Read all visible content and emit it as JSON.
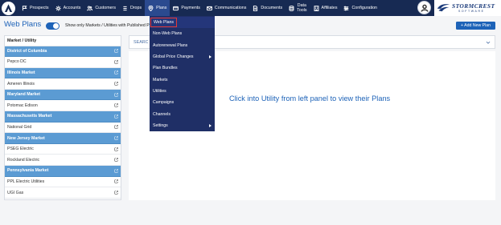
{
  "nav": {
    "items": [
      {
        "label": "Prospects",
        "icon": "flag-icon"
      },
      {
        "label": "Accounts",
        "icon": "gear-icon"
      },
      {
        "label": "Customers",
        "icon": "users-icon"
      },
      {
        "label": "Drops",
        "icon": "drop-icon"
      },
      {
        "label": "Plans",
        "icon": "pin-icon"
      },
      {
        "label": "Payments",
        "icon": "card-icon"
      },
      {
        "label": "Communications",
        "icon": "mail-icon"
      },
      {
        "label": "Documents",
        "icon": "document-icon"
      },
      {
        "label_line1": "Data",
        "label_line2": "Tools",
        "icon": "database-icon"
      },
      {
        "label": "Affiliates",
        "icon": "building-icon"
      },
      {
        "label": "Configuration",
        "icon": "sliders-icon"
      }
    ],
    "active": "Plans"
  },
  "brand": {
    "name": "STORMCREST",
    "sub": "SOFTWARE"
  },
  "page": {
    "title": "Web Plans",
    "toggle_label": "Show only Markets / Utilities with Published P",
    "toggle_on": true,
    "add_button": "+ Add New Plan"
  },
  "left_panel": {
    "header": "Market / Utility",
    "rows": [
      {
        "type": "market",
        "label": "District of Columbia"
      },
      {
        "type": "utility",
        "label": "Pepco DC"
      },
      {
        "type": "market",
        "label": "Illinois Market"
      },
      {
        "type": "utility",
        "label": "Ameren Illinois"
      },
      {
        "type": "market",
        "label": "Maryland Market"
      },
      {
        "type": "utility",
        "label": "Potomac Edison"
      },
      {
        "type": "market",
        "label": "Massachusetts Market"
      },
      {
        "type": "utility",
        "label": "National Grid"
      },
      {
        "type": "market",
        "label": "New Jersey Market"
      },
      {
        "type": "utility",
        "label": "PSEG Electric"
      },
      {
        "type": "utility",
        "label": "Rockland Electric"
      },
      {
        "type": "market",
        "label": "Pennsylvania Market"
      },
      {
        "type": "utility",
        "label": "PPL Electric Utilities"
      },
      {
        "type": "utility",
        "label": "UGI Gas"
      }
    ]
  },
  "search": {
    "label": "SEARC"
  },
  "main": {
    "empty_message": "Click into Utility from left panel to view their Plans"
  },
  "plans_menu": {
    "items": [
      {
        "label": "Web Plans",
        "highlighted": true,
        "submenu": false
      },
      {
        "label": "Non-Web Plans",
        "submenu": false
      },
      {
        "label": "Autorenewal Plans",
        "submenu": false
      },
      {
        "label": "Global Price Changes",
        "submenu": true
      },
      {
        "label": "Plan Bundles",
        "submenu": false
      },
      {
        "label": "Markets",
        "submenu": false
      },
      {
        "label": "Utilities",
        "submenu": false
      },
      {
        "label": "Campaigns",
        "submenu": false
      },
      {
        "label": "Channels",
        "submenu": false
      },
      {
        "label": "Settings",
        "submenu": true
      }
    ]
  },
  "colors": {
    "nav_bg": "#172a53",
    "accent": "#1e63b8",
    "market_row": "#5b9bd3",
    "menu_bg": "#1f2f66",
    "highlight_border": "#e53935"
  }
}
